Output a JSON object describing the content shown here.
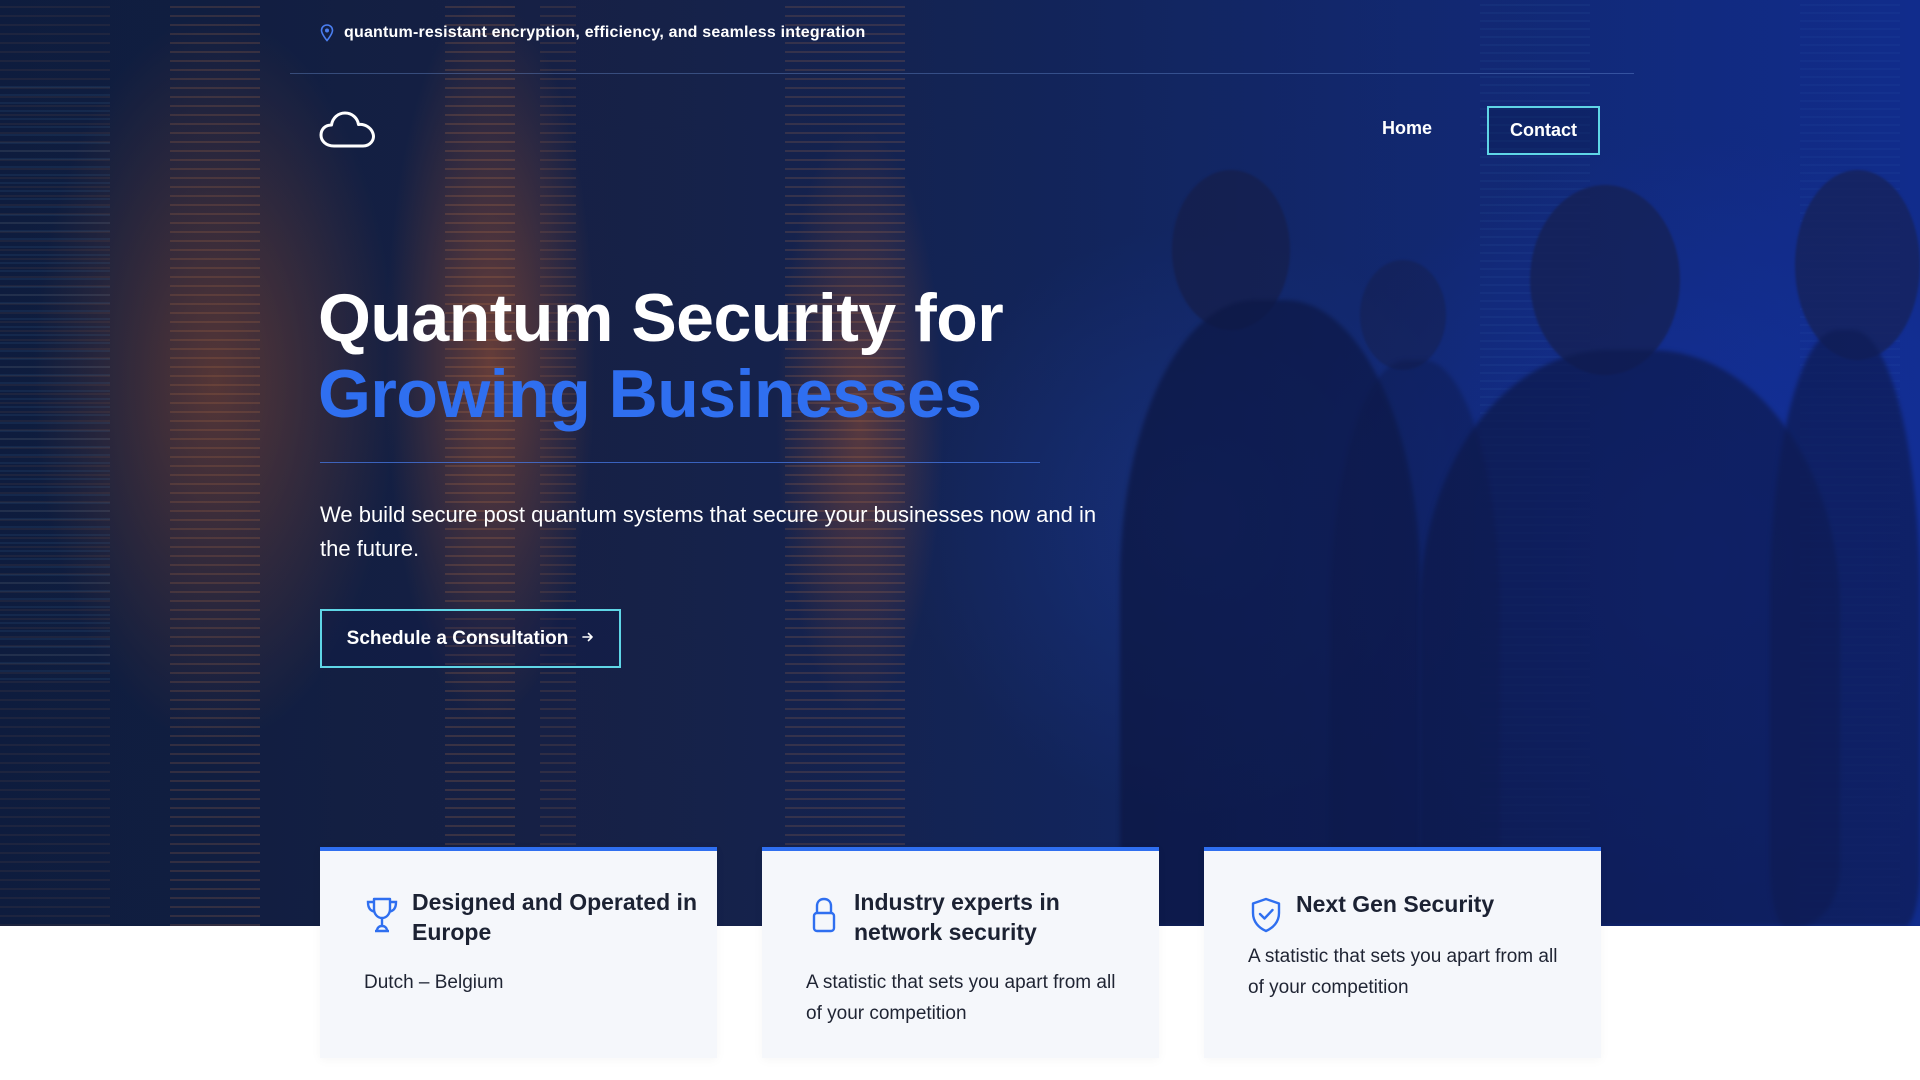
{
  "topbar": {
    "icon": "location-pin-icon",
    "tagline": "quantum-resistant encryption, efficiency, and seamless integration"
  },
  "nav": {
    "logo_icon": "cloud-icon",
    "items": [
      {
        "label": "Home"
      },
      {
        "label": "Contact"
      }
    ]
  },
  "hero": {
    "headline_line1": "Quantum Security for",
    "headline_line2": "Growing Businesses",
    "subtitle": "We build secure post quantum systems that secure your businesses now and in the future.",
    "cta_label": "Schedule a Consultation",
    "cta_icon": "arrow-right-icon"
  },
  "features": [
    {
      "icon": "trophy-icon",
      "title": "Designed and Operated in Europe",
      "description": "Dutch – Belgium"
    },
    {
      "icon": "lock-icon",
      "title": "Industry experts in network security",
      "description": "A statistic that sets you apart from all of your competition"
    },
    {
      "icon": "shield-check-icon",
      "title": "Next Gen Security",
      "description": "A statistic that sets you apart from all of your competition"
    }
  ],
  "colors": {
    "accent_blue": "#2f6ff0",
    "button_border": "#5fd6e6",
    "hero_dark": "#0c1a4a",
    "card_bg": "#f5f7fb"
  }
}
